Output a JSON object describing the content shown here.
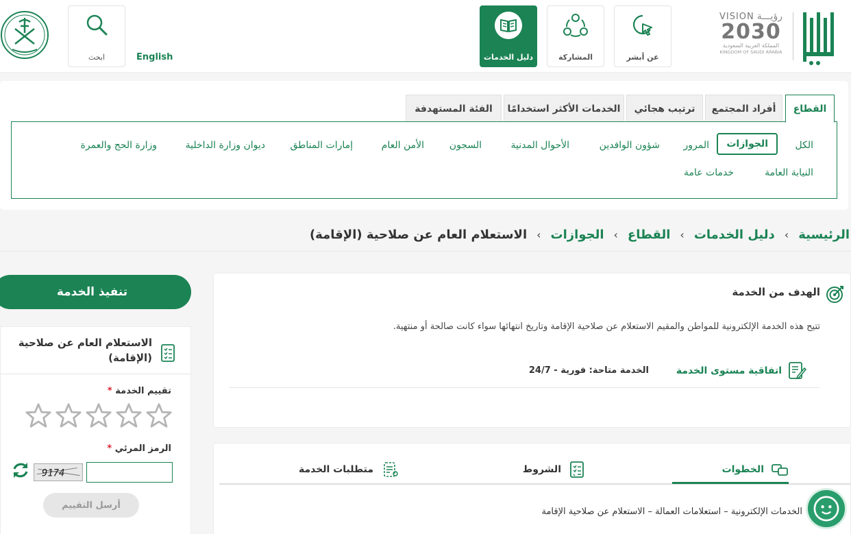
{
  "header": {
    "vision": {
      "word_en": "VISION",
      "word_ar": "رؤيـــة",
      "year": "2030",
      "kingdom_ar": "المملكة العربية السعودية",
      "kingdom_en": "KINGDOM OF SAUDI ARABIA"
    },
    "nav": {
      "about": "عن أبشر",
      "participation": "المشاركة",
      "services_guide": "دليل الخدمات"
    },
    "search_label": "ابحث",
    "language_link": "English"
  },
  "category_tabs": [
    "القطاع",
    "أفراد المجتمع",
    "ترتيب هجائي",
    "الخدمات الأكثر استخدامًا",
    "الفئة المستهدفة"
  ],
  "sectors_row1": [
    "الكل",
    "الجوازات",
    "المرور",
    "شؤون الوافدين",
    "الأحوال المدنية",
    "السجون",
    "الأمن العام",
    "إمارات المناطق",
    "ديوان وزارة الداخلية",
    "وزارة الحج والعمرة"
  ],
  "sectors_row2": [
    "النيابة العامة",
    "خدمات عامة"
  ],
  "breadcrumb": {
    "home": "الرئيسية",
    "guide": "دليل الخدمات",
    "sector": "القطاع",
    "passports": "الجوازات",
    "current": "الاستعلام العام عن صلاحية (الإقامة)",
    "separator": "‹"
  },
  "purpose": {
    "title": "الهدف من الخدمة",
    "description": "تتيح هذه الخدمة الإلكترونية للمواطن والمقيم الاستعلام عن صلاحية الإقامة وتاريخ انتهائها سواء كانت صالحة أو منتهية.",
    "sla_label": "اتفاقية مستوى الخدمة",
    "availability": "الخدمة متاحة: فورية - 24/7"
  },
  "steps": {
    "tabs": {
      "steps": "الخطوات",
      "conditions": "الشروط",
      "requirements": "متطلبات الخدمة"
    },
    "path_text": "الخدمات الإلكترونية – استعلامات العمالة – الاستعلام عن صلاحية الإقامة"
  },
  "sidebar": {
    "execute_button": "تنفيذ الخدمة",
    "service_title": "الاستعلام العام عن صلاحية (الإقامة)",
    "rating_label": "تقييم الخدمة",
    "captcha_label": "الرمز المرئي",
    "required_mark": "*",
    "captcha_text": "9174",
    "captcha_input_value": "",
    "star_count": 5,
    "star_rating": 0,
    "send_button": "أرسل التقييم"
  },
  "colors": {
    "brand_green": "#1b8354",
    "required_red": "#d9232e"
  },
  "icons": [
    "absher-logo",
    "vision-2030-logo",
    "pointer-icon",
    "participation-icon",
    "book-icon",
    "search-icon",
    "saudi-emblem",
    "target-icon",
    "document-edit-icon",
    "steps-icon",
    "checklist-icon",
    "requirements-icon",
    "refresh-icon",
    "star-icon",
    "chatbot-icon"
  ]
}
